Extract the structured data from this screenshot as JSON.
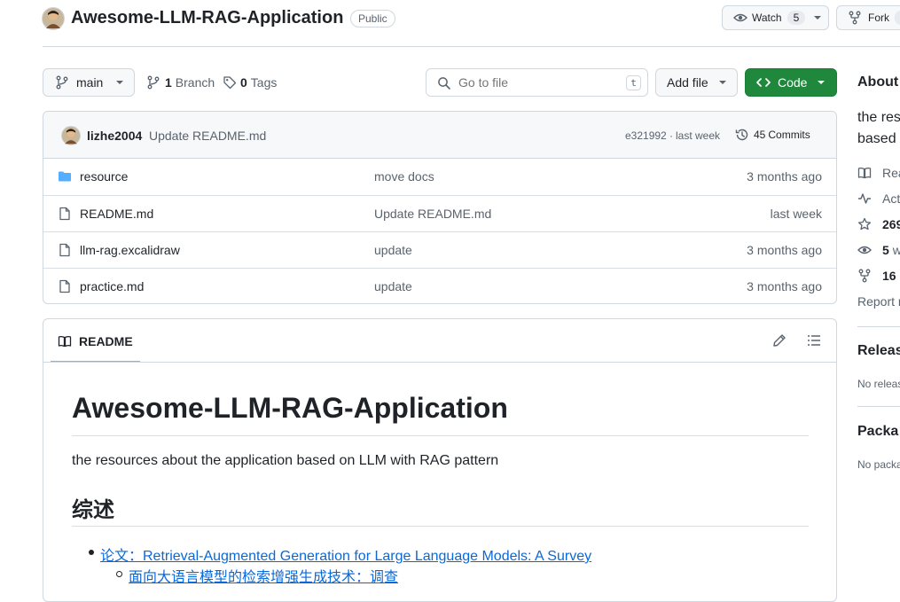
{
  "repo": {
    "name": "Awesome-LLM-RAG-Application",
    "visibility": "Public",
    "watch_label": "Watch",
    "watch_count": "5",
    "fork_label": "Fork"
  },
  "toolbar": {
    "branch": "main",
    "branch_count": "1",
    "branch_label": "Branch",
    "tag_count": "0",
    "tag_label": "Tags",
    "search_placeholder": "Go to file",
    "search_shortcut": "t",
    "add_file": "Add file",
    "code": "Code"
  },
  "commit": {
    "author": "lizhe2004",
    "message": "Update README.md",
    "hash": "e321992",
    "separator": "·",
    "time": "last week",
    "commits_count": "45",
    "commits_label": "Commits"
  },
  "files": [
    {
      "type": "folder",
      "name": "resource",
      "message": "move docs",
      "age": "3 months ago"
    },
    {
      "type": "file",
      "name": "README.md",
      "message": "Update README.md",
      "age": "last week"
    },
    {
      "type": "file",
      "name": "llm-rag.excalidraw",
      "message": "update",
      "age": "3 months ago"
    },
    {
      "type": "file",
      "name": "practice.md",
      "message": "update",
      "age": "3 months ago"
    }
  ],
  "readme": {
    "tab": "README",
    "title": "Awesome-LLM-RAG-Application",
    "description": "the resources about the application based on LLM with RAG pattern",
    "section_heading": "综述",
    "list": [
      {
        "text": "论文：Retrieval-Augmented Generation for Large Language Models: A Survey"
      },
      {
        "text": "面向大语言模型的检索增强生成技术：调查",
        "nested": true
      }
    ]
  },
  "sidebar": {
    "about_title": "About",
    "about_line1": "the res",
    "about_line2": "based",
    "readme_link": "Rea",
    "activity_link": "Act",
    "stars_count": "269",
    "watching_count": "5",
    "watching_label": "w",
    "forks_count": "16",
    "report": "Report r",
    "releases_title": "Releas",
    "releases_text": "No releas",
    "packages_title": "Packa",
    "packages_text": "No packa"
  },
  "colors": {
    "accent_green": "#1f883d",
    "link_blue": "#0969da",
    "border": "#d0d7de",
    "folder_blue": "#54aeff",
    "tab_underline": "#fd8c73"
  }
}
